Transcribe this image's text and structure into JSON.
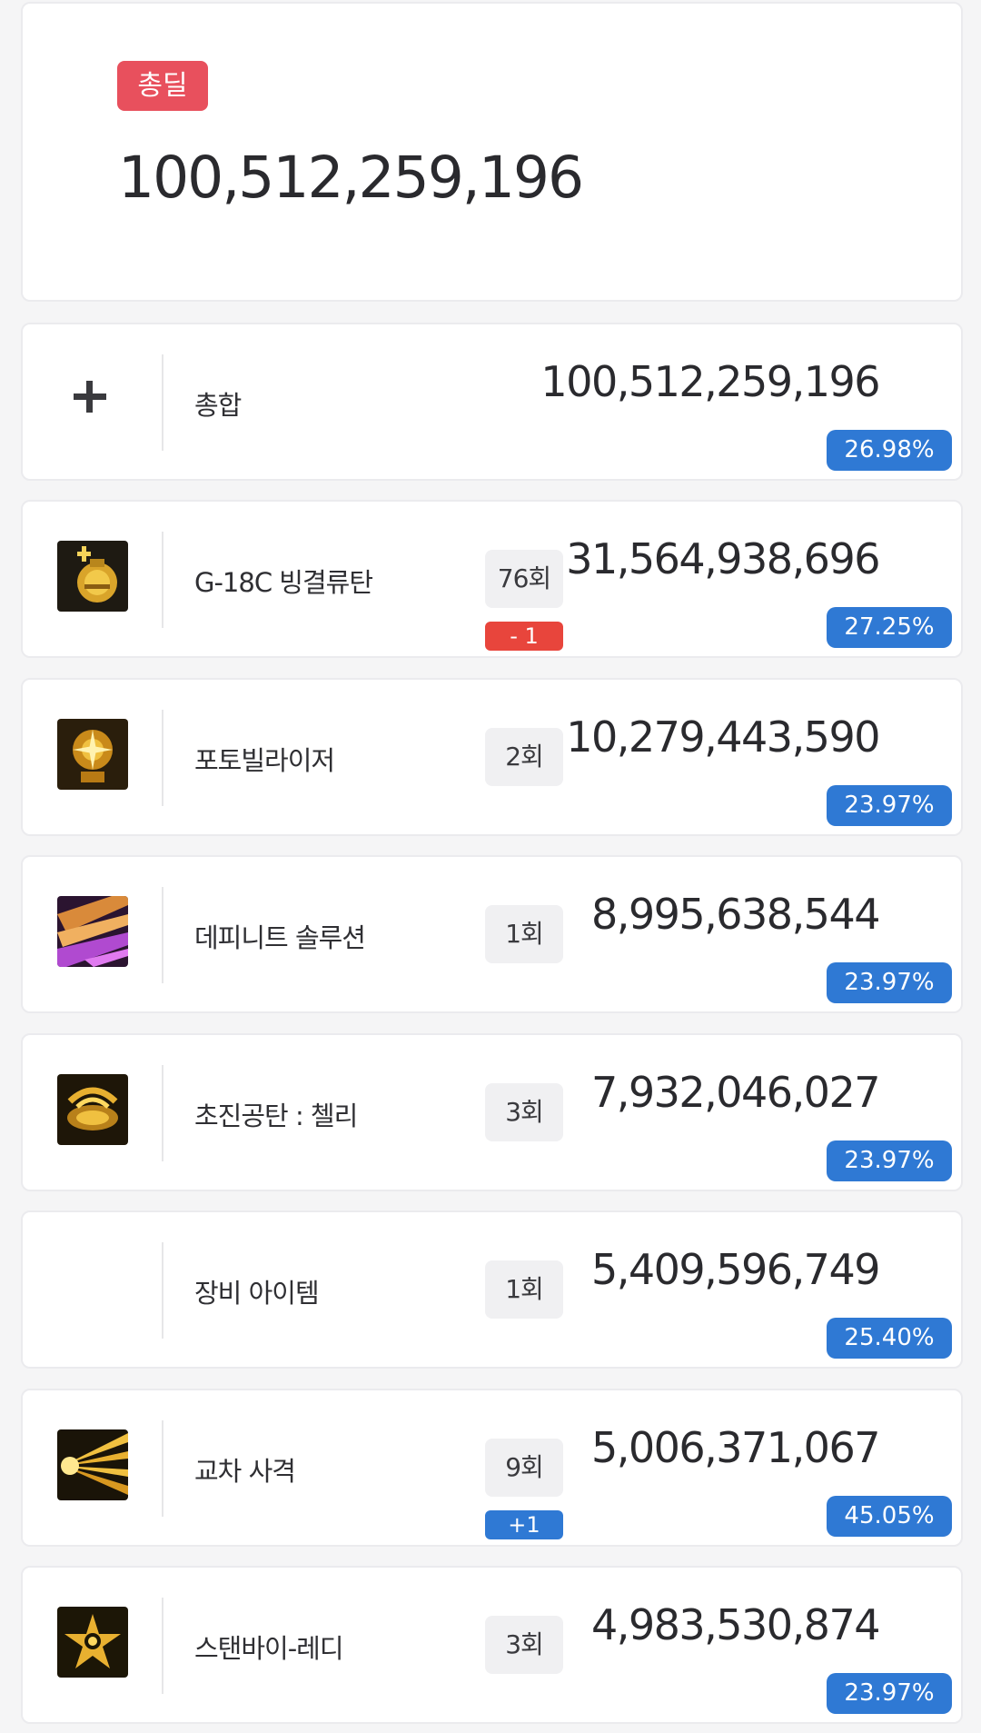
{
  "total": {
    "badge": "총딜",
    "value": "100,512,259,196"
  },
  "summary": {
    "icon": "plus-icon",
    "name": "총합",
    "damage": "100,512,259,196",
    "percent": "26.98%"
  },
  "skills": [
    {
      "icon": "grenade-icon",
      "name": "G-18C 빙결류탄",
      "count": "76회",
      "delta": "- 1",
      "delta_type": "negative",
      "damage": "31,564,938,696",
      "percent": "27.25%"
    },
    {
      "icon": "photo-blaster-icon",
      "name": "포토빌라이저",
      "count": "2회",
      "damage": "10,279,443,590",
      "percent": "23.97%"
    },
    {
      "icon": "definite-solution-icon",
      "name": "데피니트 솔루션",
      "count": "1회",
      "damage": "8,995,638,544",
      "percent": "23.97%"
    },
    {
      "icon": "shell-icon",
      "name": "초진공탄 : 첼리",
      "count": "3회",
      "damage": "7,932,046,027",
      "percent": "23.97%"
    },
    {
      "icon": "",
      "name": "장비 아이템",
      "count": "1회",
      "damage": "5,409,596,749",
      "percent": "25.40%"
    },
    {
      "icon": "cross-fire-icon",
      "name": "교차 사격",
      "count": "9회",
      "delta": "+1",
      "delta_type": "positive",
      "damage": "5,006,371,067",
      "percent": "45.05%"
    },
    {
      "icon": "standby-ready-icon",
      "name": "스탠바이-레디",
      "count": "3회",
      "damage": "4,983,530,874",
      "percent": "23.97%"
    }
  ]
}
